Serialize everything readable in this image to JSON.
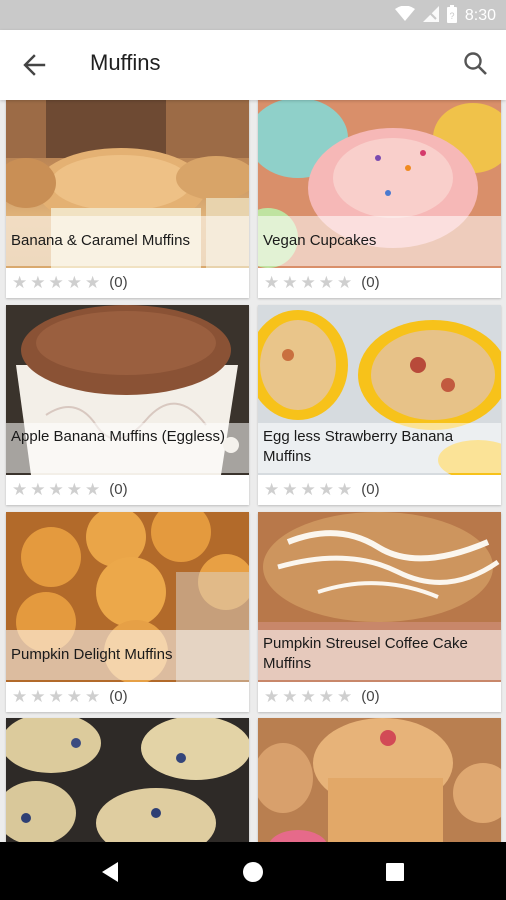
{
  "status_bar": {
    "time": "8:30"
  },
  "app_bar": {
    "title": "Muffins"
  },
  "recipes": [
    {
      "name": "Banana & Caramel Muffins",
      "rating_count": "(0)",
      "stars": 0
    },
    {
      "name": "Vegan Cupcakes",
      "rating_count": "(0)",
      "stars": 0
    },
    {
      "name": "Apple Banana Muffins (Eggless)",
      "rating_count": "(0)",
      "stars": 0
    },
    {
      "name": "Egg less Strawberry Banana Muffins",
      "rating_count": "(0)",
      "stars": 0
    },
    {
      "name": "Pumpkin Delight Muffins",
      "rating_count": "(0)",
      "stars": 0
    },
    {
      "name": "Pumpkin Streusel Coffee Cake Muffins",
      "rating_count": "(0)",
      "stars": 0
    },
    {
      "name": "",
      "rating_count": "",
      "stars": 0
    },
    {
      "name": "",
      "rating_count": "",
      "stars": 0
    }
  ]
}
